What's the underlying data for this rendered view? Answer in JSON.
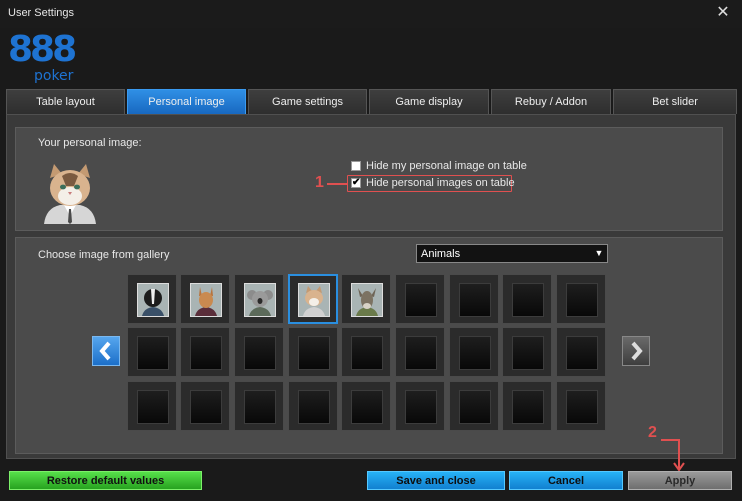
{
  "window": {
    "title": "User Settings"
  },
  "logo": {
    "number": "888",
    "brand": "poker"
  },
  "tabs": [
    {
      "label": "Table layout"
    },
    {
      "label": "Personal image"
    },
    {
      "label": "Game settings"
    },
    {
      "label": "Game display"
    },
    {
      "label": "Rebuy / Addon"
    },
    {
      "label": "Bet slider"
    }
  ],
  "personal": {
    "heading": "Your personal image:",
    "hide_my_image": {
      "label": "Hide my personal image on table",
      "checked": false
    },
    "hide_images": {
      "label": "Hide personal images on table",
      "checked": true
    }
  },
  "gallery": {
    "heading": "Choose image from gallery",
    "category_selected": "Animals",
    "avatars": [
      "skunk",
      "kangaroo",
      "koala",
      "cat",
      "donkey"
    ],
    "selected_index": 3
  },
  "annotations": {
    "step1": "1",
    "step2": "2"
  },
  "buttons": {
    "restore": "Restore default values",
    "save_close": "Save and close",
    "cancel": "Cancel",
    "apply": "Apply"
  },
  "colors": {
    "accent_blue": "#1e73d2",
    "active_tab": "#2a8ce4",
    "annotation_red": "#e05050",
    "restore_green": "#3bc232"
  }
}
